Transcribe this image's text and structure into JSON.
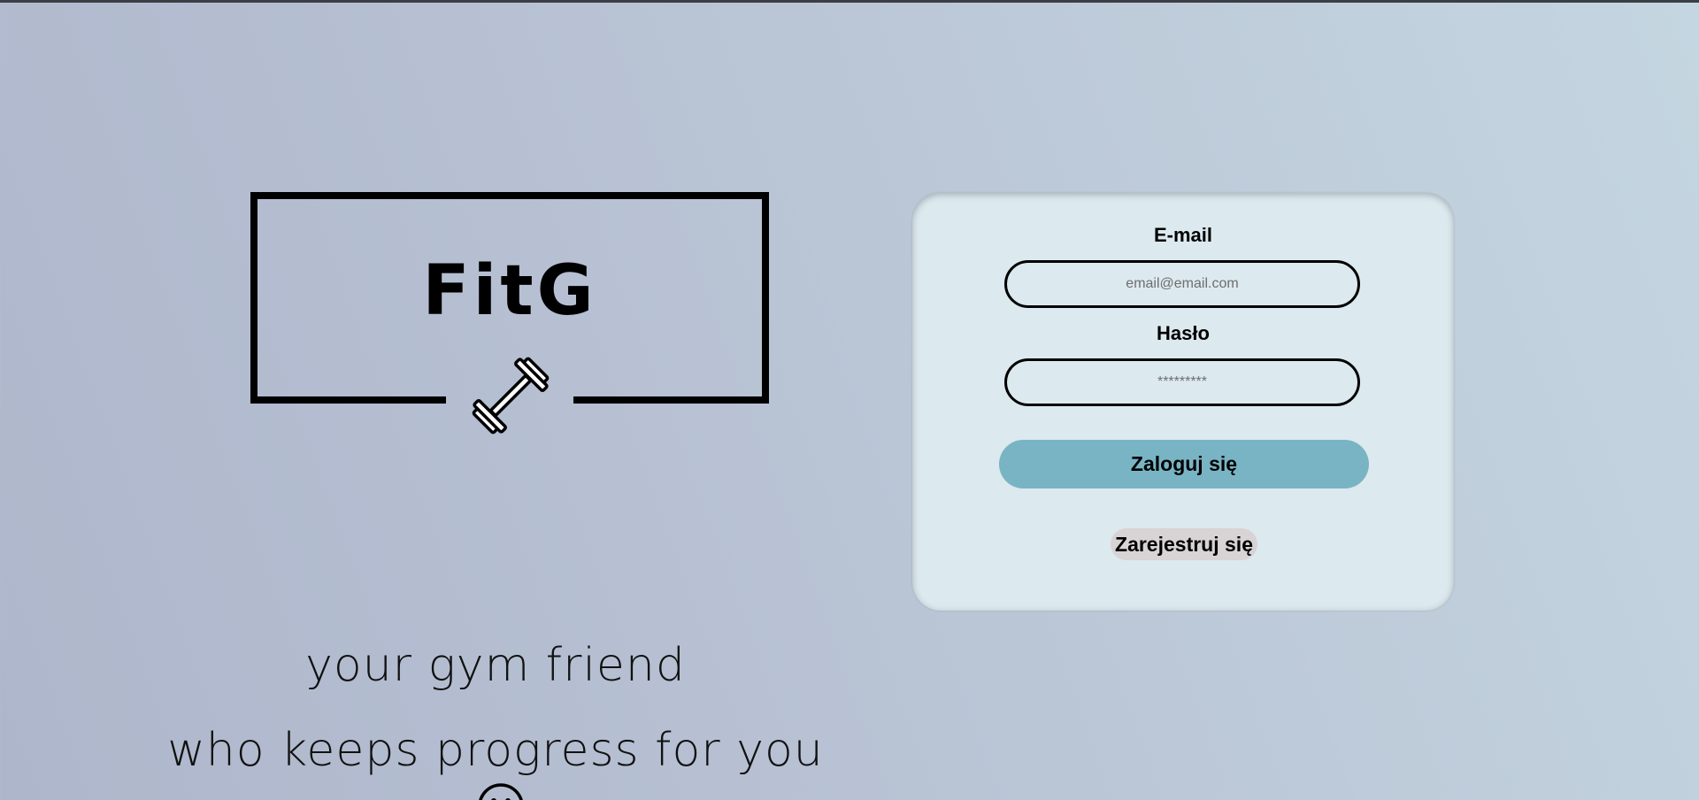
{
  "logo": {
    "text": "FitG",
    "icon": "dumbbell-icon"
  },
  "tagline": {
    "line1": "your gym friend",
    "line2": "who keeps progress for you",
    "emoji_icon": "smiley-icon"
  },
  "login_form": {
    "email_label": "E-mail",
    "email_placeholder": "email@email.com",
    "email_value": "",
    "password_label": "Hasło",
    "password_placeholder": "*********",
    "password_value": "",
    "login_button": "Zaloguj się",
    "register_button": "Zarejestruj się"
  },
  "colors": {
    "background_start": "#aeb6cb",
    "background_end": "#c4d6e1",
    "card_background": "#dce9ef",
    "login_button": "#79b4c5",
    "register_button": "#d8d3d4",
    "top_strip": "#3b3e44"
  }
}
